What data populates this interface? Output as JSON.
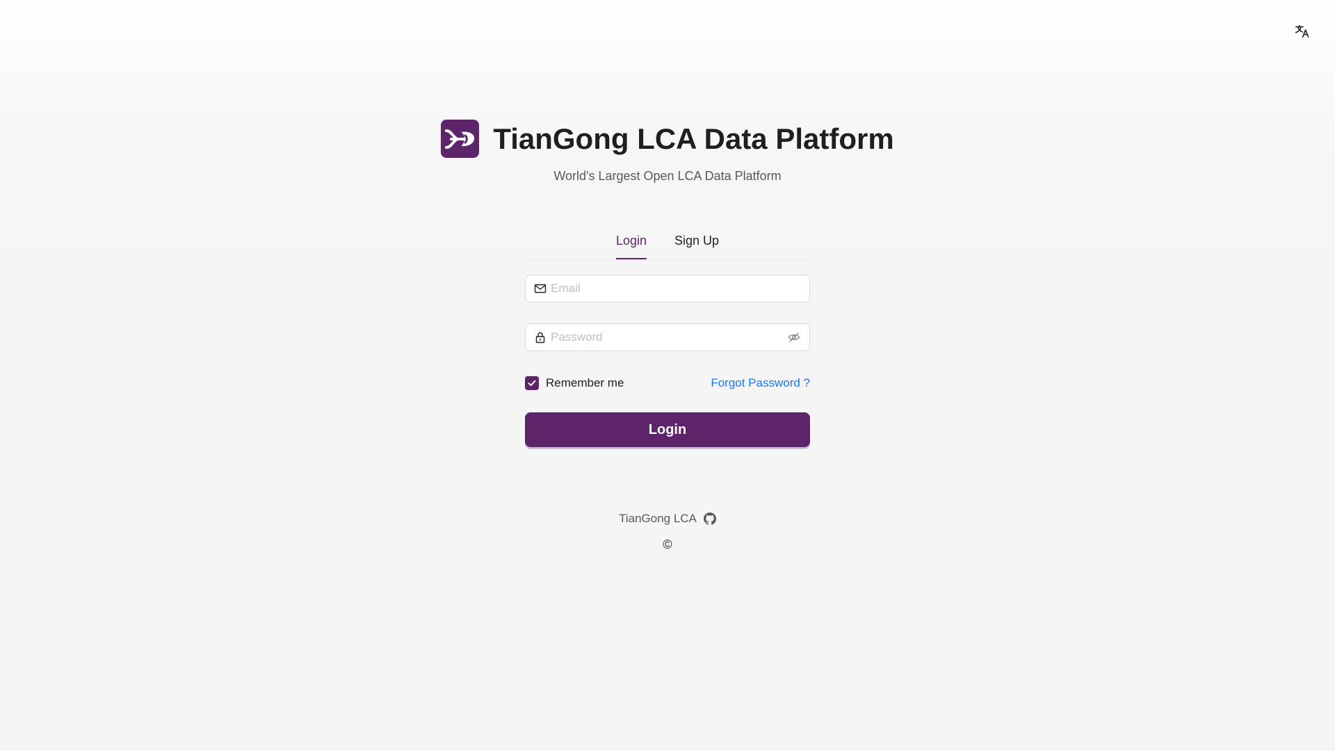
{
  "header": {
    "title": "TianGong LCA Data Platform",
    "subtitle": "World's Largest Open LCA Data Platform"
  },
  "language_icon": "translate-icon",
  "tabs": [
    {
      "label": "Login",
      "active": true
    },
    {
      "label": "Sign Up",
      "active": false
    }
  ],
  "form": {
    "email": {
      "placeholder": "Email",
      "value": "",
      "icon": "mail-icon"
    },
    "password": {
      "placeholder": "Password",
      "value": "",
      "icon": "lock-icon",
      "toggle_icon": "eye-invisible-icon"
    },
    "remember_label": "Remember me",
    "remember_checked": true,
    "forgot_label": "Forgot Password ?",
    "submit_label": "Login"
  },
  "footer": {
    "brand": "TianGong LCA",
    "github_icon": "github-icon",
    "copyright": "©"
  },
  "colors": {
    "primary": "#5e2469",
    "link": "#1677ff",
    "background": "#f5f5f5"
  }
}
